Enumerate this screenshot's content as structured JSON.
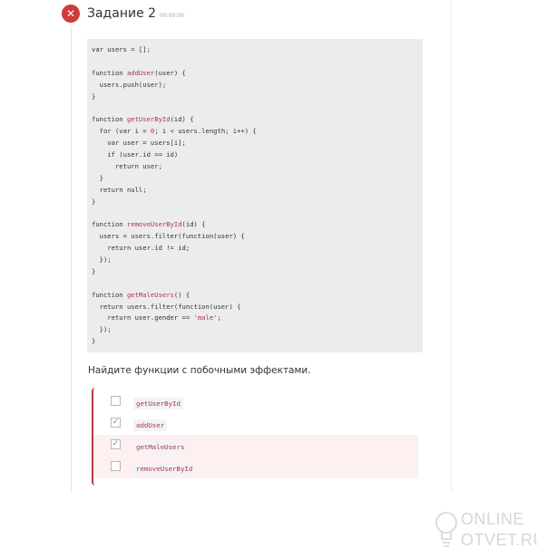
{
  "task": {
    "title": "Задание 2",
    "timer": "00:00:09",
    "status_icon": "close-icon",
    "status_color": "#cf3a3a"
  },
  "code": {
    "lines": [
      [
        {
          "t": "var users = [];"
        }
      ],
      [],
      [
        {
          "t": "function "
        },
        {
          "t": "addUser",
          "c": "fn"
        },
        {
          "t": "(user) {"
        }
      ],
      [
        {
          "t": "  users.push(user);"
        }
      ],
      [
        {
          "t": "}"
        }
      ],
      [],
      [
        {
          "t": "function "
        },
        {
          "t": "getUserById",
          "c": "fn"
        },
        {
          "t": "(id) {"
        }
      ],
      [
        {
          "t": "  for (var i = "
        },
        {
          "t": "0",
          "c": "num"
        },
        {
          "t": "; i < users.length; i++) {"
        }
      ],
      [
        {
          "t": "    var user = users[i];"
        }
      ],
      [
        {
          "t": "    if (user.id == id)"
        }
      ],
      [
        {
          "t": "      return user;"
        }
      ],
      [
        {
          "t": "  }"
        }
      ],
      [
        {
          "t": "  return null;"
        }
      ],
      [
        {
          "t": "}"
        }
      ],
      [],
      [
        {
          "t": "function "
        },
        {
          "t": "removeUserById",
          "c": "fn"
        },
        {
          "t": "(id) {"
        }
      ],
      [
        {
          "t": "  users = users.filter(function(user) {"
        }
      ],
      [
        {
          "t": "    return user.id != id;"
        }
      ],
      [
        {
          "t": "  });"
        }
      ],
      [
        {
          "t": "}"
        }
      ],
      [],
      [
        {
          "t": "function "
        },
        {
          "t": "getMaleUsers",
          "c": "fn"
        },
        {
          "t": "() {"
        }
      ],
      [
        {
          "t": "  return users.filter(function(user) {"
        }
      ],
      [
        {
          "t": "    return user.gender == "
        },
        {
          "t": "'male'",
          "c": "str"
        },
        {
          "t": ";"
        }
      ],
      [
        {
          "t": "  });"
        }
      ],
      [
        {
          "t": "}"
        }
      ]
    ]
  },
  "question": "Найдите функции с побочными эффектами.",
  "answers": [
    {
      "label": "getUserById",
      "checked": false,
      "state": "neutral"
    },
    {
      "label": "addUser",
      "checked": true,
      "state": "neutral"
    },
    {
      "label": "getMaleUsers",
      "checked": true,
      "state": "wrong"
    },
    {
      "label": "removeUserById",
      "checked": false,
      "state": "wrong"
    }
  ],
  "colors": {
    "accent_error": "#b53b3b",
    "code_highlight": "#b0306a",
    "code_background": "#ececec"
  },
  "watermark": {
    "line1": "ONLINE",
    "line2": "OTVET.RU",
    "icon": "lightbulb-icon"
  }
}
